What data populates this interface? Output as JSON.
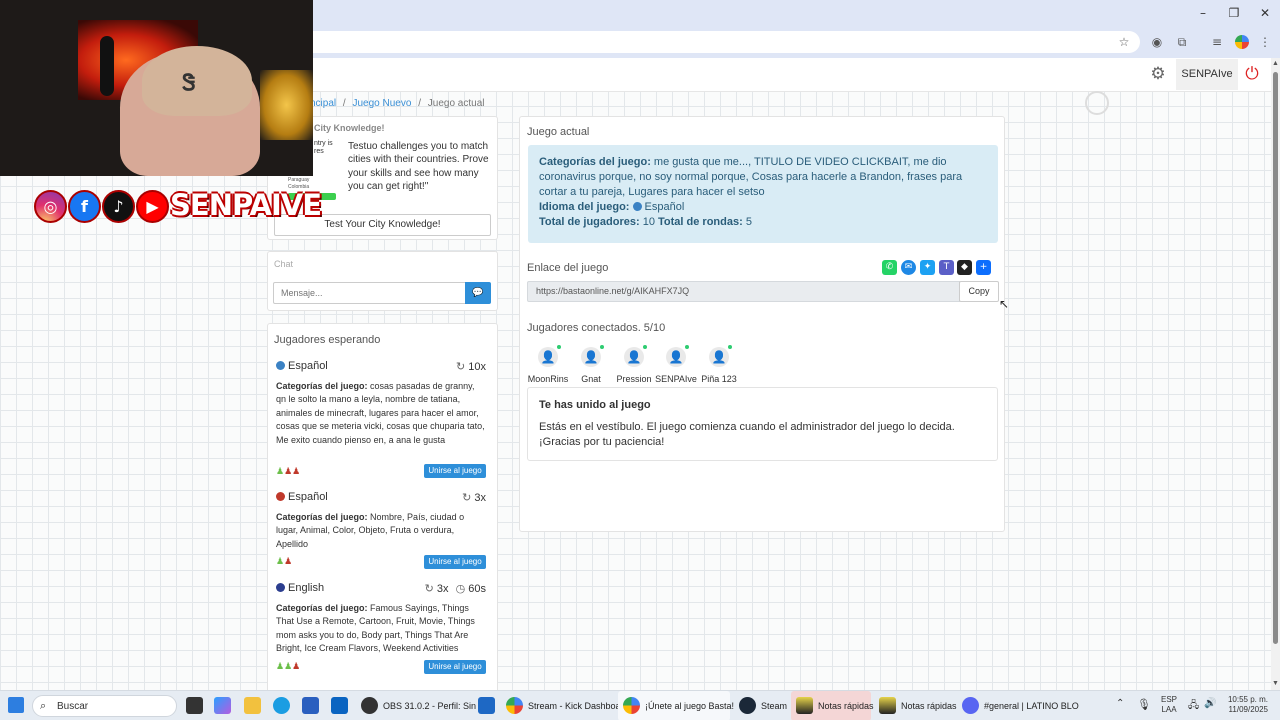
{
  "browser": {
    "profile_initial": ""
  },
  "nav": {
    "username": "SENPAIve"
  },
  "breadcrumb": {
    "item1": "ncipal",
    "sep": "/",
    "item2": "Juego Nuevo",
    "item3": "Juego actual"
  },
  "ad": {
    "title": "City Knowledge!",
    "thumb_line1": "ntry is",
    "thumb_line2": "res",
    "thumb_country1": "Paraguay",
    "thumb_country2": "Colombia",
    "description": "Testuo challenges you to match cities with their countries. Prove your skills and see how many you can get right!\"",
    "button": "Test Your City Knowledge!"
  },
  "chat": {
    "title": "Chat",
    "placeholder": "Mensaje..."
  },
  "waiting": {
    "title": "Jugadores esperando",
    "cat_label": "Categorías del juego:",
    "join_label": "Unirse al juego",
    "games": [
      {
        "language": "Español",
        "flag_color": "#3b82c4",
        "rounds": "10x",
        "time": "",
        "categories": "cosas pasadas de granny, qn le solto la mano a leyla, nombre de tatiana, animales de minecraft, lugares para hacer el amor, cosas que se meteria vicki, cosas que chuparia tato, Me exito cuando pienso en, a ana le gusta"
      },
      {
        "language": "Español",
        "flag_color": "#c0392b",
        "rounds": "3x",
        "time": "",
        "categories": "Nombre, País, ciudad o lugar, Animal, Color, Objeto, Fruta o verdura, Apellido"
      },
      {
        "language": "English",
        "flag_color": "#2c3e8f",
        "rounds": "3x",
        "time": "60s",
        "categories": "Famous Sayings, Things That Use a Remote, Cartoon, Fruit, Movie, Things mom asks you to do, Body part, Things That Are Bright, Ice Cream Flavors, Weekend Activities"
      }
    ]
  },
  "current": {
    "title": "Juego actual",
    "cat_label": "Categorías del juego:",
    "categories": "me gusta que me..., TITULO DE VIDEO CLICKBAIT, me dio coronavirus porque, no soy normal porque, Cosas para hacerle a Brandon, frases para cortar a tu pareja, Lugares para hacer el setso",
    "lang_label": "Idioma del juego:",
    "language": "Español",
    "players_label": "Total de jugadores:",
    "players": "10",
    "rounds_label": "Total de rondas:",
    "rounds": "5",
    "link_label": "Enlace del juego",
    "link": "https://bastaonline.net/g/AIKAHFX7JQ",
    "copy": "Copy",
    "connected_label": "Jugadores conectados. 5/10",
    "connected": [
      "MoonRins",
      "Gnat",
      "Pression",
      "SENPAIve",
      "Piña 123"
    ],
    "joined_title": "Te has unido al juego",
    "joined_text": "Estás en el vestíbulo. El juego comienza cuando el administrador del juego lo decida. ¡Gracias por tu paciencia!"
  },
  "overlay": {
    "brand": "SENPAIVE"
  },
  "taskbar": {
    "search": "Buscar",
    "apps": [
      {
        "label": "OBS 31.0.2 - Perfil: Sin"
      },
      {
        "label": "Stream - Kick Dashboa"
      },
      {
        "label": "¡Únete al juego Basta!"
      },
      {
        "label": "Steam"
      },
      {
        "label": "Notas rápidas"
      },
      {
        "label": "Notas rápidas"
      },
      {
        "label": "#general | LATINO BLO"
      }
    ],
    "lang1": "ESP",
    "lang2": "LAA",
    "time": "10:55 p. m.",
    "date": "11/09/2025"
  },
  "colors": {
    "accent": "#2e8fd9",
    "info_bg": "#d9ecf5",
    "info_text": "#2a5d7a"
  }
}
